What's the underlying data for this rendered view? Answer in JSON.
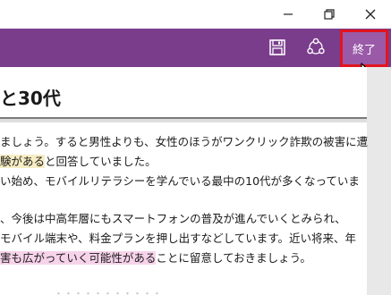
{
  "window": {
    "minimize_icon": "minimize-icon",
    "restore_icon": "restore-icon",
    "close_icon": "close-icon"
  },
  "toolbar": {
    "save_icon": "save-icon",
    "share_icon": "share-icon",
    "exit_label": "終了",
    "background_color": "#7a3d8c",
    "exit_highlight_color": "#e3141e"
  },
  "article": {
    "heading": "と30代",
    "paragraphs": [
      {
        "line1": "ましょう。すると男性よりも、女性のほうがワンクリック詐欺の被害に遭",
        "line2_highlight": "験がある",
        "line2_rest": "と回答していました。"
      },
      {
        "line1": "い始め、モバイルリテラシーを学んでいる最中の10代が多くなっていま"
      },
      {
        "line1": "、今後は中高年層にもスマートフォンの普及が進んでいくとみられ、",
        "line2": "モバイル端末や、料金プランを押し出すなどしています。近い将来、年",
        "line3_highlight": "害も広がっていく可能性がある",
        "line3_rest": "ことに留意しておきましょう。"
      }
    ],
    "faded_next_heading": "・・・・・・・・・・・"
  }
}
